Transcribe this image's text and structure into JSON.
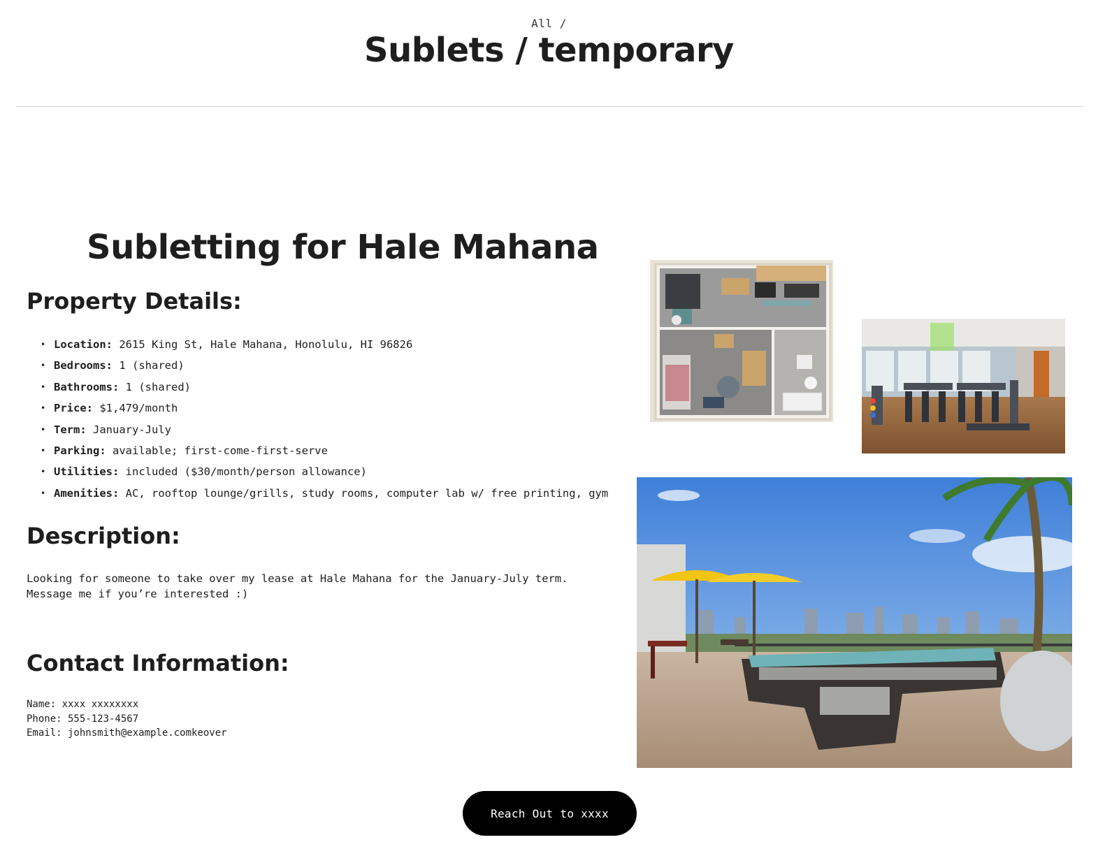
{
  "breadcrumb": {
    "parent": "All",
    "separator": "/"
  },
  "page_title": "Sublets / temporary",
  "listing": {
    "title": "Subletting for Hale Mahana",
    "details_heading": "Property Details:",
    "details": [
      {
        "label": "Location:",
        "value": "2615 King St, Hale Mahana, Honolulu, HI 96826"
      },
      {
        "label": "Bedrooms:",
        "value": "1 (shared)"
      },
      {
        "label": "Bathrooms:",
        "value": "1 (shared)"
      },
      {
        "label": "Price:",
        "value": "$1,479/month"
      },
      {
        "label": "Term:",
        "value": "January-July"
      },
      {
        "label": "Parking:",
        "value": "available; first-come-first-serve"
      },
      {
        "label": "Utilities:",
        "value": "included ($30/month/person allowance)"
      },
      {
        "label": "Amenities:",
        "value": "AC, rooftop lounge/grills, study rooms, computer lab w/ free printing, gym"
      }
    ],
    "description_heading": "Description:",
    "description_lines": [
      "Looking for someone to take over my lease at Hale Mahana for the January-July term.",
      "Message me if you’re interested :)"
    ],
    "contact_heading": "Contact Information:",
    "contact": {
      "name": "Name: xxxx xxxxxxxx",
      "phone": "Phone: 555-123-4567",
      "email": "Email: johnsmith@example.comkeover"
    }
  },
  "cta": {
    "label": "Reach Out to xxxx"
  },
  "photos": {
    "floorplan": "floor-plan-image",
    "gym": "gym-image",
    "rooftop": "rooftop-lounge-image"
  },
  "colors": {
    "text": "#1e1e1e",
    "button_bg": "#000000",
    "button_text": "#ffffff",
    "divider": "#cfcfcf"
  }
}
